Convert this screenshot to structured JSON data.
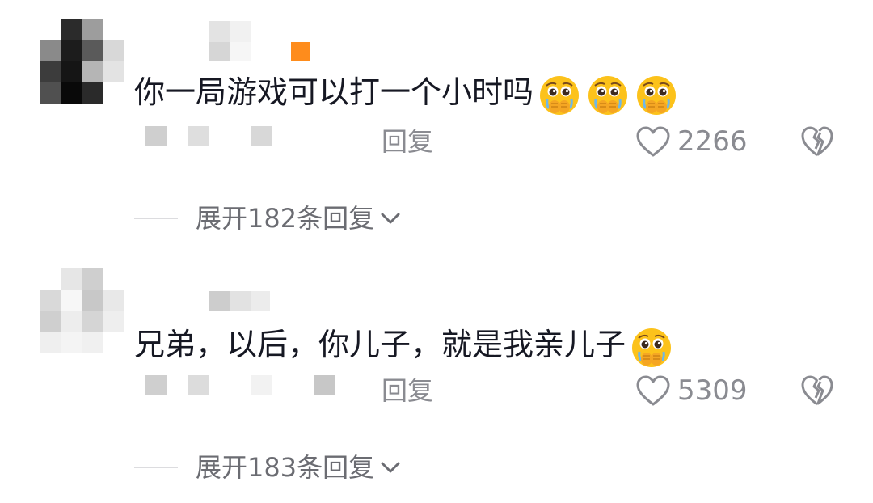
{
  "comments": [
    {
      "text": "你一局游戏可以打一个小时吗",
      "emoji_count": 3,
      "emoji_icon": "pleading-face-hands-over-mouth-emoji",
      "reply_label": "回复",
      "likes": "2266",
      "expand_label": "展开182条回复"
    },
    {
      "text": "兄弟，以后，你儿子，就是我亲儿子",
      "emoji_count": 1,
      "emoji_icon": "pleading-face-hands-over-mouth-emoji",
      "reply_label": "回复",
      "likes": "5309",
      "expand_label": "展开183条回复"
    }
  ],
  "colors": {
    "text_primary": "#161823",
    "text_secondary": "#8a8b91",
    "accent_badge": "#fe8c1c"
  }
}
